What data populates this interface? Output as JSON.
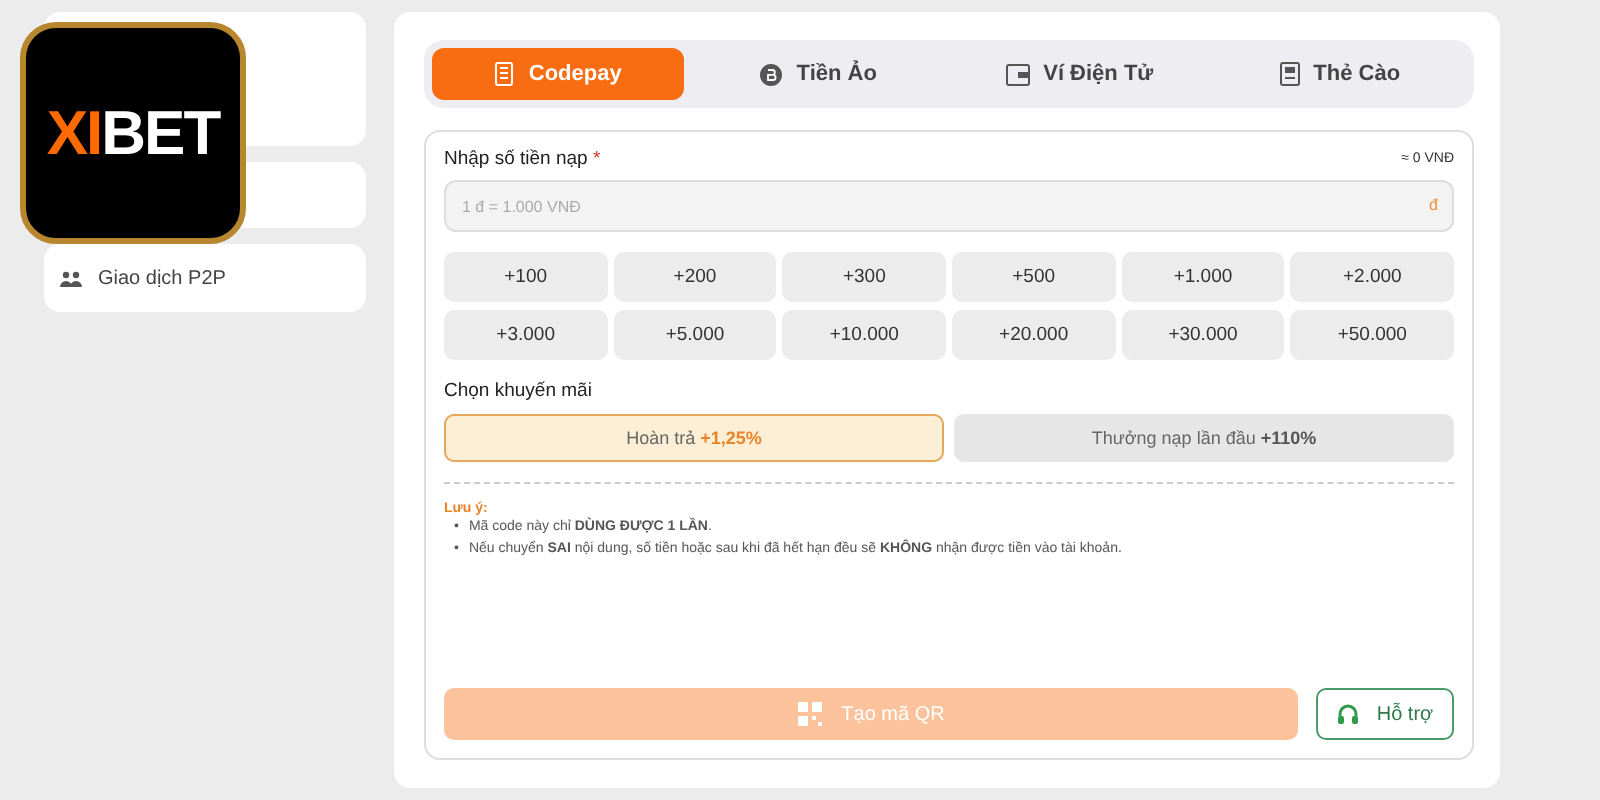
{
  "logo": {
    "highlight": "XI",
    "rest": "BET"
  },
  "sidebar": {
    "items": [
      {
        "label": "Giao dịch P2P"
      }
    ]
  },
  "tabs": [
    {
      "label": "Codepay",
      "kind": "receipt",
      "selected": true
    },
    {
      "label": "Tiền Ảo",
      "kind": "coin",
      "selected": false
    },
    {
      "label": "Ví Điện Tử",
      "kind": "wallet",
      "selected": false
    },
    {
      "label": "Thẻ Cào",
      "kind": "card",
      "selected": false
    }
  ],
  "amount": {
    "label": "Nhập số tiền nạp",
    "required_mark": "*",
    "converted": "≈ 0 VNĐ",
    "placeholder": "1 đ = 1.000 VNĐ",
    "unit": "đ"
  },
  "quick_amounts": [
    "+100",
    "+200",
    "+300",
    "+500",
    "+1.000",
    "+2.000",
    "+3.000",
    "+5.000",
    "+10.000",
    "+20.000",
    "+30.000",
    "+50.000"
  ],
  "promotions": {
    "label": "Chọn khuyến mãi",
    "options": [
      {
        "text": "Hoàn trả",
        "value": "+1,25%",
        "selected": true
      },
      {
        "text": "Thưởng nạp lần đầu",
        "value": "+110%",
        "selected": false
      }
    ]
  },
  "notes": {
    "title": "Lưu ý:",
    "items": [
      {
        "bullet": "•",
        "text": "Mã code này chỉ **DÙNG ĐƯỢC 1 LẦN**."
      },
      {
        "bullet": "•",
        "text": "Nếu chuyển **SAI** nội dung, số tiền hoặc sau khi đã hết hạn đều sẽ **KHÔNG** nhận được tiền vào tài khoản."
      }
    ]
  },
  "qr_button": {
    "label": "Tạo mã QR",
    "disabled": true
  },
  "support_button": {
    "label": "Hỗ trợ"
  }
}
